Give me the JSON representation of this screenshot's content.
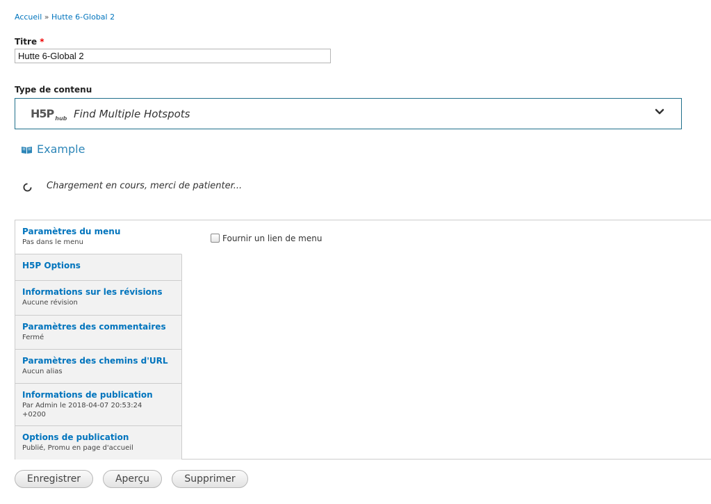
{
  "breadcrumb": {
    "home": "Accueil",
    "separator": "»",
    "current": "Hutte 6-Global 2"
  },
  "title_field": {
    "label": "Titre",
    "required_mark": "*",
    "value": "Hutte 6-Global 2"
  },
  "content_type": {
    "label": "Type de contenu",
    "hub_logo": "H5P",
    "hub_logo_sub": "hub",
    "selected": "Find Multiple Hotspots"
  },
  "example_link": "Example",
  "loading_text": "Chargement en cours, merci de patienter...",
  "vertical_tabs": [
    {
      "title": "Paramètres du menu",
      "summary": "Pas dans le menu"
    },
    {
      "title": "H5P Options",
      "summary": ""
    },
    {
      "title": "Informations sur les révisions",
      "summary": "Aucune révision"
    },
    {
      "title": "Paramètres des commentaires",
      "summary": "Fermé"
    },
    {
      "title": "Paramètres des chemins d'URL",
      "summary": "Aucun alias"
    },
    {
      "title": "Informations de publication",
      "summary": "Par Admin le 2018-04-07 20:53:24 +0200"
    },
    {
      "title": "Options de publication",
      "summary": "Publié, Promu en page d'accueil"
    }
  ],
  "menu_pane": {
    "checkbox_label": "Fournir un lien de menu",
    "checked": false
  },
  "buttons": {
    "save": "Enregistrer",
    "preview": "Aperçu",
    "delete": "Supprimer"
  },
  "colors": {
    "link": "#0074bd",
    "h5p_border": "#1f6f8b",
    "example": "#2d86b8"
  }
}
